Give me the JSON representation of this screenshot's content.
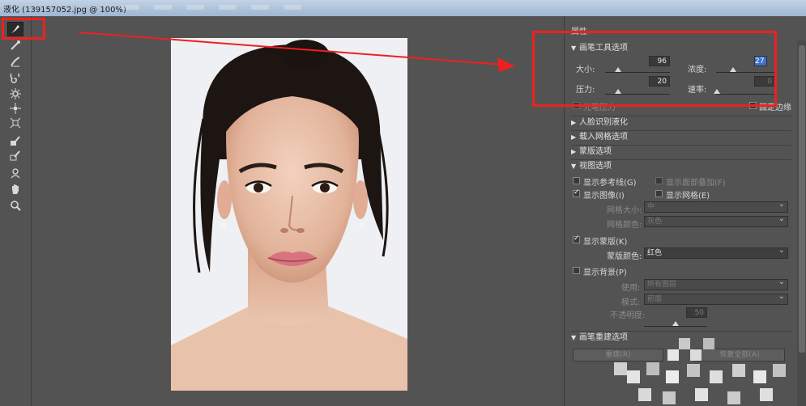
{
  "window": {
    "title": "液化 (139157052.jpg @ 100%)"
  },
  "panel": {
    "title": "属性"
  },
  "brush_tool_options": {
    "header": "画笔工具选项",
    "size_label": "大小:",
    "size_value": "96",
    "density_label": "浓度:",
    "density_value": "27",
    "pressure_label": "压力:",
    "pressure_value": "20",
    "rate_label": "速率:",
    "rate_value": "0",
    "stylus_label": "光笔压力",
    "pin_edges_label": "固定边缘",
    "slider_levels": {
      "size": 0.2,
      "density": 0.25,
      "pressure": 0.2,
      "rate": 0.0
    }
  },
  "sections": {
    "face_aware": "人脸识别液化",
    "load_mesh": "载入网格选项",
    "mask": "蒙版选项",
    "view": "视图选项",
    "brush_reconstruct": "画笔重建选项"
  },
  "view_options": {
    "show_guides": "显示参考线(G)",
    "show_face_overlay": "显示面部叠加(F)",
    "show_image": "显示图像(I)",
    "show_mesh": "显示网格(E)",
    "mesh_size_label": "网格大小:",
    "mesh_size_value": "中",
    "mesh_color_label": "网格颜色:",
    "mesh_color_value": "灰色",
    "show_mask": "显示蒙版(K)",
    "mask_color_label": "蒙版颜色:",
    "mask_color_value": "红色",
    "show_backdrop": "显示背景(P)",
    "use_label": "使用:",
    "use_value": "所有图层",
    "mode_label": "模式:",
    "mode_value": "前面",
    "opacity_label": "不透明度:",
    "opacity_value": "50",
    "opacity_level": 0.5
  },
  "reconstruct": {
    "reconstruct_button": "重建(R)",
    "restore_all_button": "恢复全部(A)"
  },
  "colors": {
    "highlight": "#ef2020",
    "accent": "#3f6fcf"
  },
  "tools": [
    "forward-warp-tool-icon",
    "reconstruct-tool-icon",
    "smooth-tool-icon",
    "twirl-tool-icon",
    "pucker-tool-icon",
    "bloat-tool-icon",
    "push-left-tool-icon",
    "freeze-mask-tool-icon",
    "thaw-mask-tool-icon",
    "face-tool-icon",
    "hand-tool-icon",
    "zoom-tool-icon"
  ]
}
